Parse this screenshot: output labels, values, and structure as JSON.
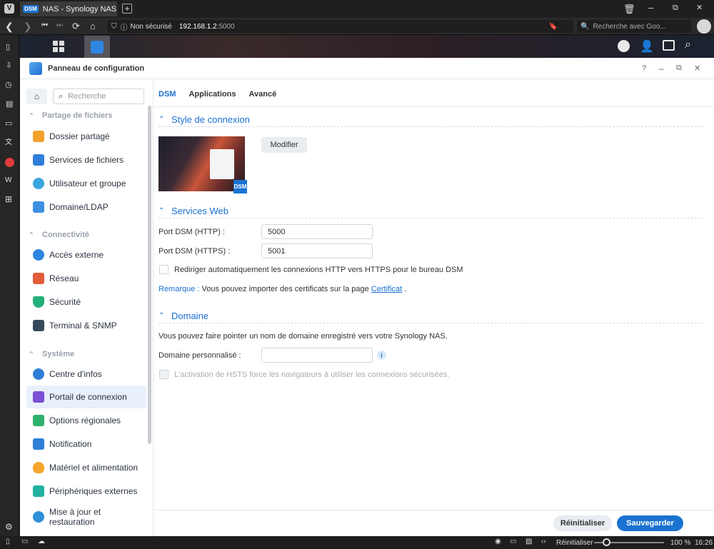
{
  "browser": {
    "tab_title": "NAS - Synology NAS",
    "tab_badge": "DSM",
    "security_label": "Non sécurisé",
    "url_host": "192.168.1.2",
    "url_port": ":5000",
    "search_placeholder": "Recherche avec Goo...",
    "status_reset": "Réinitialiser",
    "zoom": "100 %",
    "time": "16:26"
  },
  "window": {
    "title": "Panneau de configuration",
    "help": "?",
    "minimize": "–",
    "restore": "⧉",
    "close": "✕"
  },
  "sidebar": {
    "search_placeholder": "Recherche",
    "sections": [
      {
        "label": "Partage de fichiers",
        "items": [
          {
            "label": "Dossier partagé",
            "color": "#f2a12c"
          },
          {
            "label": "Services de fichiers",
            "color": "#2f7fd8"
          },
          {
            "label": "Utilisateur et groupe",
            "color": "#3aa6e0"
          },
          {
            "label": "Domaine/LDAP",
            "color": "#3d8fe0"
          }
        ]
      },
      {
        "label": "Connectivité",
        "items": [
          {
            "label": "Accès externe",
            "color": "#2f86e0"
          },
          {
            "label": "Réseau",
            "color": "#e25c3a"
          },
          {
            "label": "Sécurité",
            "color": "#22b07a"
          },
          {
            "label": "Terminal & SNMP",
            "color": "#37495c"
          }
        ]
      },
      {
        "label": "Système",
        "items": [
          {
            "label": "Centre d'infos",
            "color": "#2f7fd8"
          },
          {
            "label": "Portail de connexion",
            "color": "#7b4fd6"
          },
          {
            "label": "Options régionales",
            "color": "#2fb26b"
          },
          {
            "label": "Notification",
            "color": "#2f7fd8"
          },
          {
            "label": "Matériel et alimentation",
            "color": "#f4a62a"
          },
          {
            "label": "Périphériques externes",
            "color": "#22b0a0"
          },
          {
            "label": "Mise à jour et restauration",
            "color": "#2f8fd8"
          }
        ]
      }
    ]
  },
  "tabs": [
    {
      "label": "DSM",
      "active": true
    },
    {
      "label": "Applications",
      "active": false
    },
    {
      "label": "Avancé",
      "active": false
    }
  ],
  "login_style": {
    "heading": "Style de connexion",
    "modify_button": "Modifier",
    "thumb_badge": "DSM"
  },
  "web_services": {
    "heading": "Services Web",
    "http_label": "Port DSM (HTTP) :",
    "http_value": "5000",
    "https_label": "Port DSM (HTTPS) :",
    "https_value": "5001",
    "redirect_label": "Rediriger automatiquement les connexions HTTP vers HTTPS pour le bureau DSM",
    "note_prefix": "Remarque :",
    "note_text": "Vous pouvez importer des certificats sur la page",
    "note_link": "Certificat",
    "note_suffix": "."
  },
  "domain": {
    "heading": "Domaine",
    "description": "Vous pouvez faire pointer un nom de domaine enregistré vers votre Synology NAS.",
    "custom_label": "Domaine personnalisé :",
    "custom_value": "",
    "hsts_label": "L'activation de HSTS force les navigateurs à utiliser les connexions sécurisées."
  },
  "footer": {
    "reset": "Réinitialiser",
    "save": "Sauvegarder"
  }
}
